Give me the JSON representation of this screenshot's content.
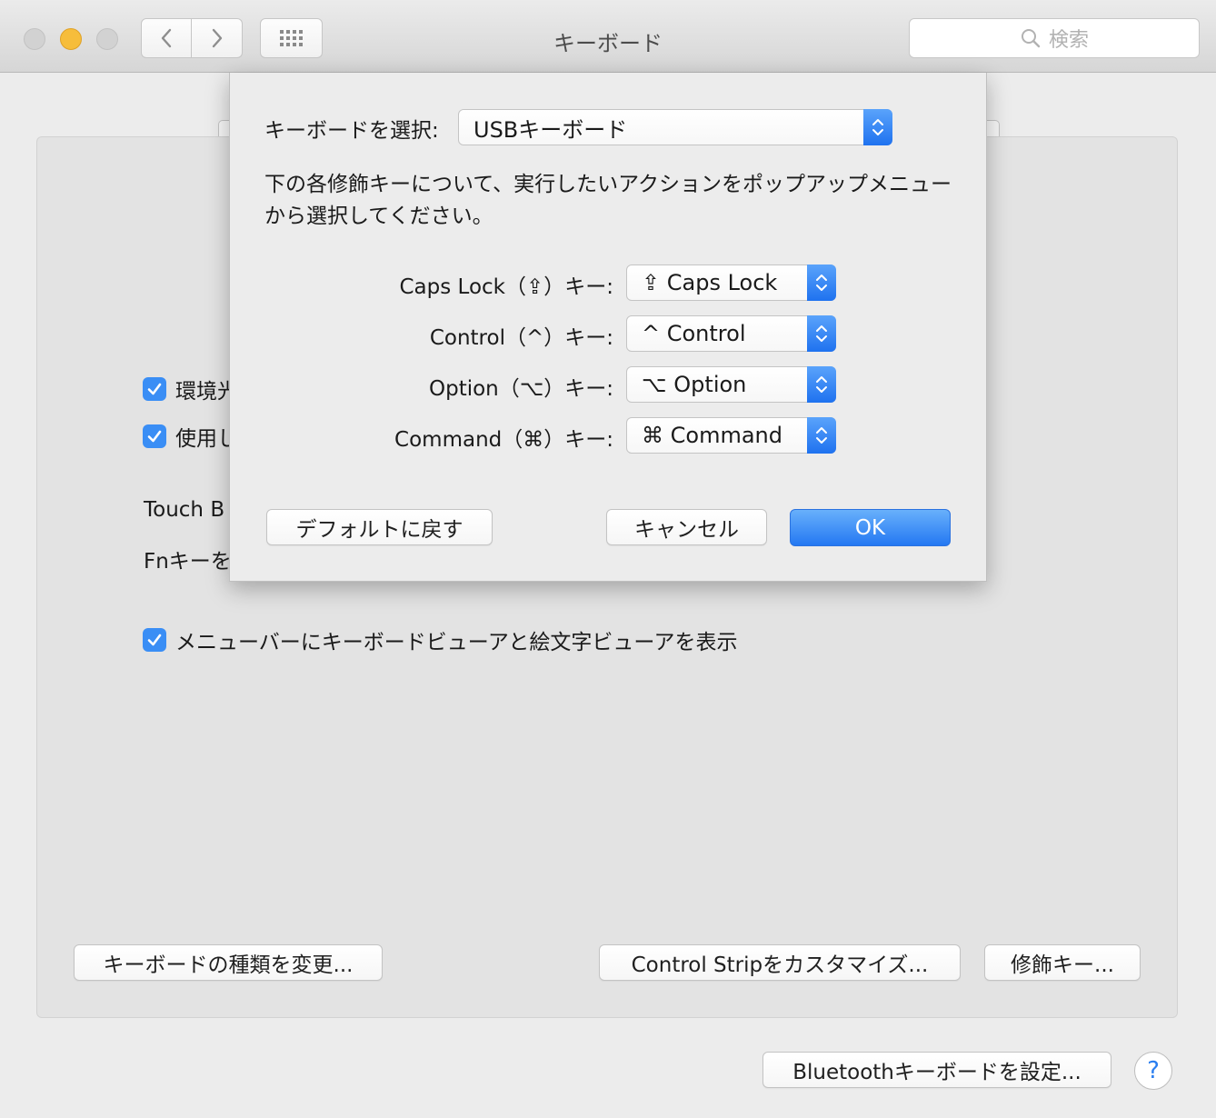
{
  "window": {
    "title": "キーボード",
    "search_placeholder": "検索"
  },
  "main": {
    "checkbox_ambient": "環境光",
    "checkbox_use": "使用し",
    "touchbar_text": "Touch B",
    "fn_text": "Fnキーを",
    "checkbox_menubar": "メニューバーにキーボードビューアと絵文字ビューアを表示",
    "change_keyboard_type_button": "キーボードの種類を変更...",
    "customize_control_strip_button": "Control Stripをカスタマイズ...",
    "modifier_keys_button": "修飾キー...",
    "bluetooth_keyboard_button": "Bluetoothキーボードを設定...",
    "help_button": "?"
  },
  "sheet": {
    "select_keyboard_label": "キーボードを選択:",
    "select_keyboard_value": "USBキーボード",
    "description": "下の各修飾キーについて、実行したいアクションをポップアップメニューから選択してください。",
    "modifiers": [
      {
        "label": "Caps Lock（⇪）キー:",
        "value": "⇪ Caps Lock"
      },
      {
        "label": "Control（^）キー:",
        "value": "^ Control"
      },
      {
        "label": "Option（⌥）キー:",
        "value": "⌥ Option"
      },
      {
        "label": "Command（⌘）キー:",
        "value": "⌘ Command"
      }
    ],
    "restore_defaults_button": "デフォルトに戻す",
    "cancel_button": "キャンセル",
    "ok_button": "OK"
  },
  "colors": {
    "accent": "#3a8ef5",
    "window_bg": "#ececec",
    "panel_bg": "#e3e3e3",
    "minimize_yellow": "#f6bd3b"
  },
  "icons": [
    "close-icon",
    "minimize-icon",
    "zoom-icon",
    "back-chevron-icon",
    "forward-chevron-icon",
    "grid-icon",
    "search-icon",
    "checkmark-icon",
    "updown-arrows-icon"
  ]
}
